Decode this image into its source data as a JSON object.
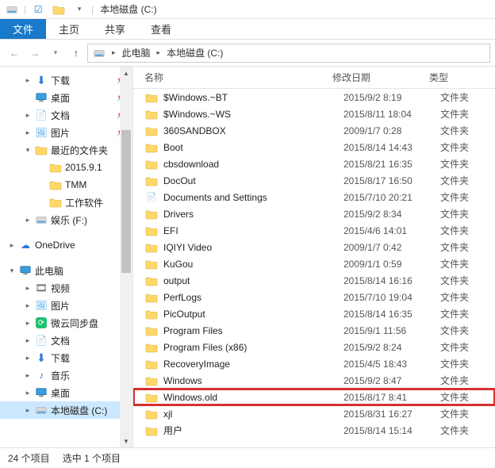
{
  "window_title": "本地磁盘 (C:)",
  "ribbon": {
    "file": "文件",
    "home": "主页",
    "share": "共享",
    "view": "查看"
  },
  "breadcrumb": {
    "pc": "此电脑",
    "drive": "本地磁盘 (C:)"
  },
  "columns": {
    "name": "名称",
    "date": "修改日期",
    "type": "类型"
  },
  "sidebar": {
    "downloads": "下载",
    "desktop": "桌面",
    "documents": "文档",
    "pictures": "图片",
    "recent": "最近的文件夹",
    "item_2015": "2015.9.1",
    "tmm": "TMM",
    "worksw": "工作软件",
    "ent": "娱乐 (F:)",
    "onedrive": "OneDrive",
    "thispc": "此电脑",
    "videos": "视频",
    "pictures2": "图片",
    "weiyun": "微云同步盘",
    "documents2": "文档",
    "downloads2": "下载",
    "music": "音乐",
    "desktop2": "桌面",
    "cdrive": "本地磁盘 (C:)"
  },
  "files": [
    {
      "name": "$Windows.~BT",
      "date": "2015/9/2 8:19",
      "type": "文件夹",
      "icon": "folder"
    },
    {
      "name": "$Windows.~WS",
      "date": "2015/8/11 18:04",
      "type": "文件夹",
      "icon": "folder"
    },
    {
      "name": "360SANDBOX",
      "date": "2009/1/7 0:28",
      "type": "文件夹",
      "icon": "folder"
    },
    {
      "name": "Boot",
      "date": "2015/8/14 14:43",
      "type": "文件夹",
      "icon": "folder"
    },
    {
      "name": "cbsdownload",
      "date": "2015/8/21 16:35",
      "type": "文件夹",
      "icon": "folder"
    },
    {
      "name": "DocOut",
      "date": "2015/8/17 16:50",
      "type": "文件夹",
      "icon": "folder"
    },
    {
      "name": "Documents and Settings",
      "date": "2015/7/10 20:21",
      "type": "文件夹",
      "icon": "shortcut"
    },
    {
      "name": "Drivers",
      "date": "2015/9/2 8:34",
      "type": "文件夹",
      "icon": "folder"
    },
    {
      "name": "EFI",
      "date": "2015/4/6 14:01",
      "type": "文件夹",
      "icon": "folder"
    },
    {
      "name": "IQIYI Video",
      "date": "2009/1/7 0:42",
      "type": "文件夹",
      "icon": "folder"
    },
    {
      "name": "KuGou",
      "date": "2009/1/1 0:59",
      "type": "文件夹",
      "icon": "folder"
    },
    {
      "name": "output",
      "date": "2015/8/14 16:16",
      "type": "文件夹",
      "icon": "folder"
    },
    {
      "name": "PerfLogs",
      "date": "2015/7/10 19:04",
      "type": "文件夹",
      "icon": "folder"
    },
    {
      "name": "PicOutput",
      "date": "2015/8/14 16:35",
      "type": "文件夹",
      "icon": "folder"
    },
    {
      "name": "Program Files",
      "date": "2015/9/1 11:56",
      "type": "文件夹",
      "icon": "folder"
    },
    {
      "name": "Program Files (x86)",
      "date": "2015/9/2 8:24",
      "type": "文件夹",
      "icon": "folder"
    },
    {
      "name": "RecoveryImage",
      "date": "2015/4/5 18:43",
      "type": "文件夹",
      "icon": "folder"
    },
    {
      "name": "Windows",
      "date": "2015/9/2 8:47",
      "type": "文件夹",
      "icon": "folder"
    },
    {
      "name": "Windows.old",
      "date": "2015/8/17 8:41",
      "type": "文件夹",
      "icon": "folder",
      "hl": true
    },
    {
      "name": "xjl",
      "date": "2015/8/31 16:27",
      "type": "文件夹",
      "icon": "folder"
    },
    {
      "name": "用户",
      "date": "2015/8/14 15:14",
      "type": "文件夹",
      "icon": "folder"
    }
  ],
  "status": {
    "count": "24 个项目",
    "selected": "选中 1 个项目"
  }
}
